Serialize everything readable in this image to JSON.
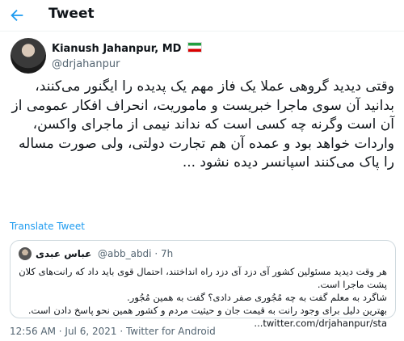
{
  "header": {
    "title": "Tweet",
    "back_icon": "arrow-left-icon"
  },
  "author": {
    "name": "Kianush Jahanpur, MD",
    "handle": "@drjahanpur",
    "flag": "🇮🇷"
  },
  "tweet": {
    "text": "وقتی دیدید گروهی عملا یک فاز مهم یک پدیده را ایگنور می‌کنند، بدانید آن سوی ماجرا خبریست و ماموریت، انحراف افکار عمومی از آن است وگرنه چه کسی است که نداند نیمی از ماجرای واکسن، واردات خواهد بود و عمده آن هم تجارت دولتی،  ولی صورت مساله را پاک می‌کنند اسپانسر دیده نشود ..."
  },
  "translate_label": "Translate Tweet",
  "quote": {
    "name": "عباس عبدی",
    "handle_time": "@abb_abdi · 7h",
    "lines": [
      "هر وقت دیدید مسئولین کشور آی دزد آی دزد راه انداختند، احتمال قوی باید داد که رانت‌های کلان پشت ماجرا است.",
      "شاگرد به معلم گفت به چه مُجُوری صفر دادی؟ گفت به همین مُجُور.",
      "بهترین دلیل برای وجود رانت به قیمت جان و حیثیت مردم و کشور همین نحو پاسخ دادن است. twitter.com/drjahanpur/sta..."
    ]
  },
  "meta": "12:56 AM · Jul 6, 2021 · Twitter for Android",
  "colors": {
    "accent": "#1d9bf0",
    "muted": "#536471",
    "border": "#cfd9de"
  }
}
